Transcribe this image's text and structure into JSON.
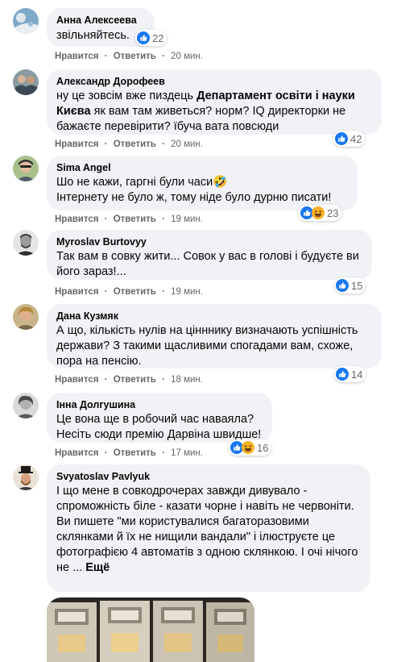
{
  "actions": {
    "like": "Нравится",
    "reply": "Ответить",
    "separator": "·"
  },
  "comments": [
    {
      "author": "Анна Алексеева",
      "text": "звільняйтесь.",
      "time": "20 мин.",
      "reactions": [
        "like"
      ],
      "count": "22"
    },
    {
      "author": "Александр Дорофеев",
      "text_before": "ну це зовсім вже пиздець ",
      "text_bold": "Департамент освіти і науки Києва",
      "text_after": " як вам там живеться? норм? IQ директорки не бажаєте перевірити? їбуча вата повсюди",
      "time": "20 мин.",
      "reactions": [
        "like"
      ],
      "count": "42"
    },
    {
      "author": "Sima Angel",
      "text_line1": "Шо не кажи, гаргні були часи🤣",
      "text_line2": "Інтернету не було ж, тому ніде було дурню писати!",
      "time": "19 мин.",
      "reactions": [
        "like",
        "haha"
      ],
      "count": "23"
    },
    {
      "author": "Myroslav Burtovyy",
      "text": "Так вам в совку жити... Совок у вас в голові і будуєте ви його зараз!...",
      "time": "19 мин.",
      "reactions": [
        "like"
      ],
      "count": "15"
    },
    {
      "author": "Дана Кузмяк",
      "text": "А що, кількість нулів на цінннику визначають успішність держави? З такими щасливими спогадами вам, схоже, пора на пенсію.",
      "time": "18 мин.",
      "reactions": [
        "like"
      ],
      "count": "14"
    },
    {
      "author": "Інна Долгушина",
      "text_line1": "Це вона ще в робочий час наваяла?",
      "text_line2": "Несіть сюди премію Дарвіна швидше!",
      "time": "17 мин.",
      "reactions": [
        "like",
        "haha"
      ],
      "count": "16"
    },
    {
      "author": "Svyatoslav Pavlyuk",
      "text_para1": "І що мене в совкодрочерах завжди дивувало - спроможність біле - казати чорне і навіть не червоніти.",
      "text_para2": "Ви пишете \"ми користувалися багаторазовими склянками й їх не нищили вандали\" і ілюструєте це фотографією 4 автоматів з одною склянкою. І очі нічого не ...",
      "see_more": "Ещё"
    }
  ],
  "colors": {
    "bubble": "#f0f2f5",
    "meta": "#65676b",
    "like_blue": "#1877f2",
    "haha_yellow": "#f7b125"
  }
}
